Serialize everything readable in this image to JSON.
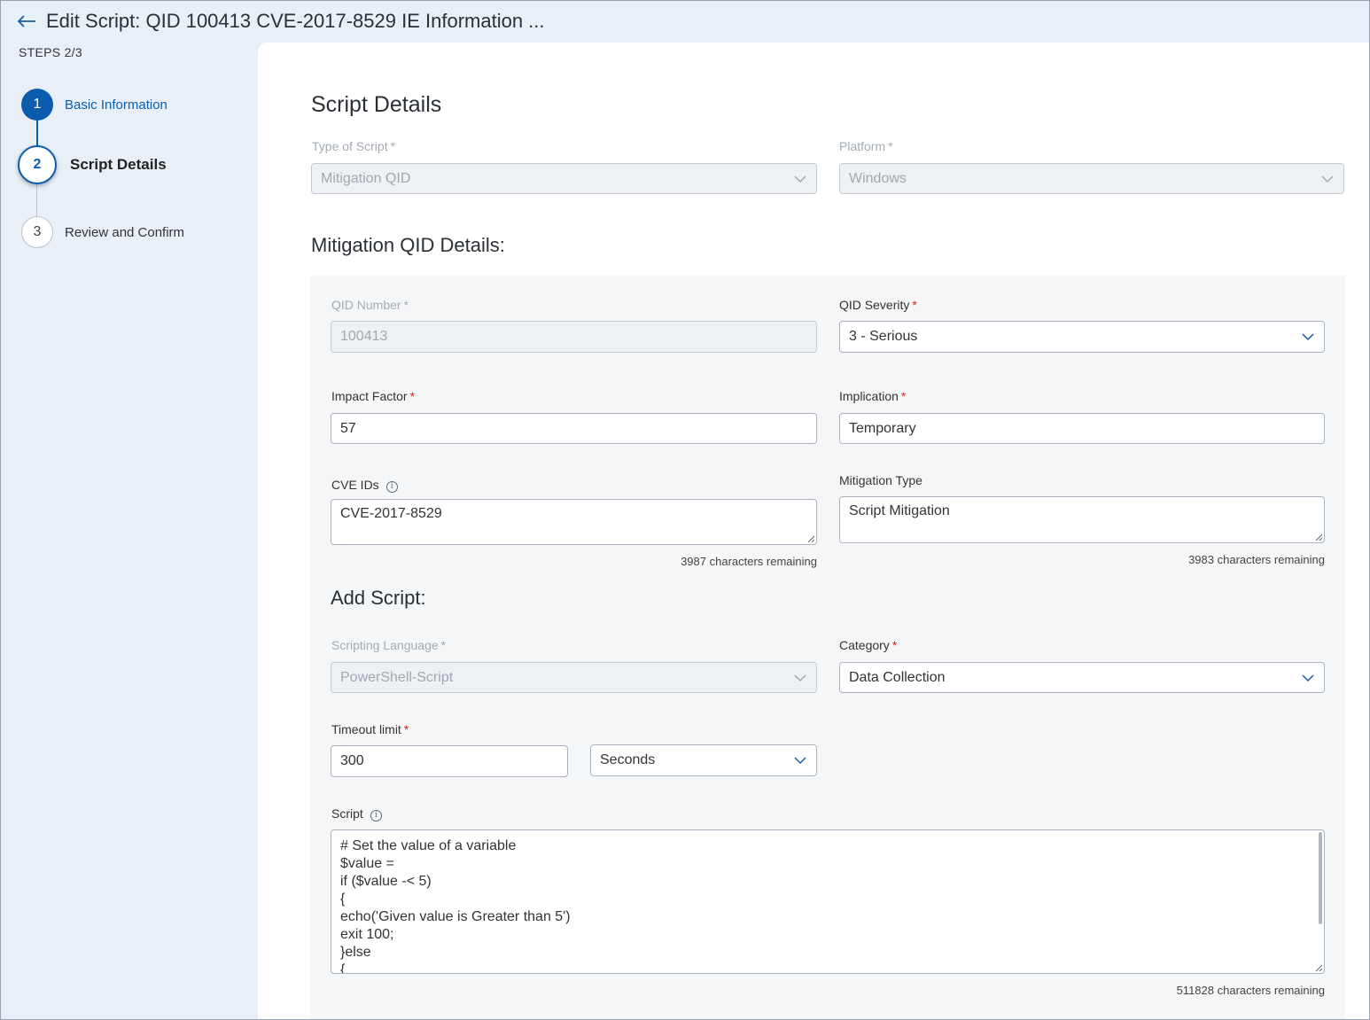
{
  "header": {
    "title": "Edit Script: QID 100413 CVE-2017-8529 IE Information ..."
  },
  "steps": {
    "label": "STEPS 2/3",
    "items": [
      {
        "number": "1",
        "label": "Basic Information"
      },
      {
        "number": "2",
        "label": "Script Details"
      },
      {
        "number": "3",
        "label": "Review and Confirm"
      }
    ]
  },
  "script_details": {
    "title": "Script Details",
    "type_of_script": {
      "label": "Type of Script",
      "value": "Mitigation QID"
    },
    "platform": {
      "label": "Platform",
      "value": "Windows"
    }
  },
  "mitigation": {
    "title": "Mitigation QID Details:",
    "qid_number": {
      "label": "QID Number",
      "value": "100413"
    },
    "qid_severity": {
      "label": "QID Severity",
      "value": "3 - Serious"
    },
    "impact_factor": {
      "label": "Impact Factor",
      "value": "57"
    },
    "implication": {
      "label": "Implication",
      "value": "Temporary"
    },
    "cve_ids": {
      "label": "CVE IDs",
      "value": "CVE-2017-8529",
      "remaining": "3987 characters remaining"
    },
    "mitigation_type": {
      "label": "Mitigation Type",
      "value": "Script Mitigation",
      "remaining": "3983 characters remaining"
    }
  },
  "add_script": {
    "title": "Add Script:",
    "scripting_language": {
      "label": "Scripting Language",
      "value": "PowerShell-Script"
    },
    "category": {
      "label": "Category",
      "value": "Data Collection"
    },
    "timeout": {
      "label": "Timeout limit",
      "value": "300",
      "unit": "Seconds"
    },
    "script": {
      "label": "Script",
      "lines": [
        "# Set the value of a variable",
        "$value =",
        "if ($value -< 5)",
        "{",
        "echo('Given value is Greater than 5')",
        "exit 100;",
        "}else",
        "{"
      ],
      "remaining": "511828 characters remaining"
    }
  },
  "required_marker": "*",
  "info_marker": "i",
  "colors": {
    "primary": "#0b5cad",
    "required": "#dd2222",
    "sidebar_bg": "#e9eff7",
    "section_bg": "#f4f6f8"
  }
}
